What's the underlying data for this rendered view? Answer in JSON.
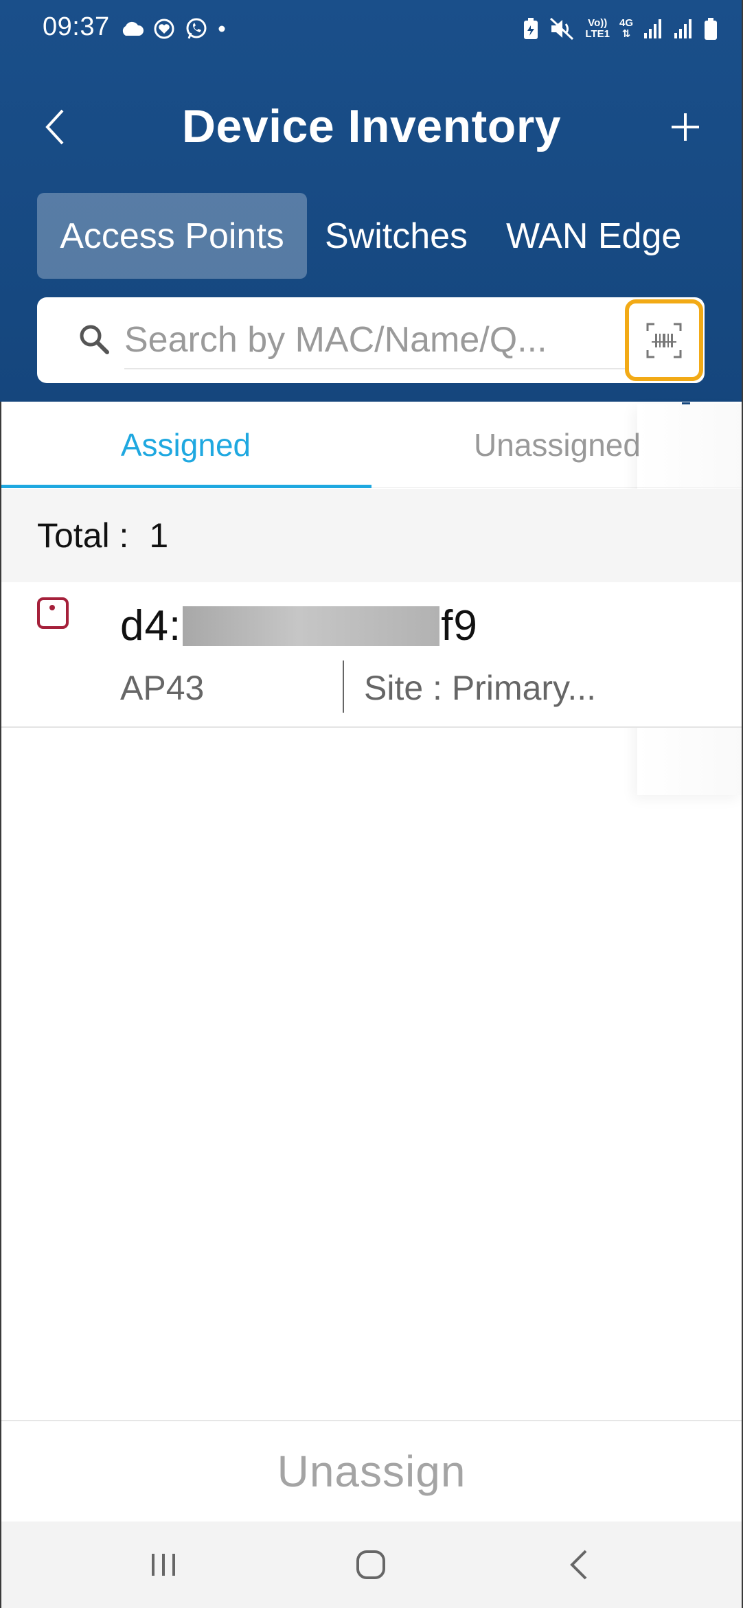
{
  "status_bar": {
    "time": "09:37",
    "left_icons": [
      "cloud-icon",
      "heart-sync-icon",
      "whatsapp-icon",
      "dot-icon"
    ],
    "right_icons": [
      "battery-saver-icon",
      "mute-icon",
      "volte-icon",
      "4g-icon",
      "signal-icon",
      "signal-icon-2",
      "battery-icon"
    ],
    "volte_label_top": "Vo))",
    "volte_label_bottom": "LTE1",
    "network_label": "4G"
  },
  "app_bar": {
    "title": "Device Inventory",
    "back_icon": "chevron-left-icon",
    "add_icon": "plus-icon"
  },
  "category_tabs": [
    {
      "label": "Access Points",
      "active": true
    },
    {
      "label": "Switches",
      "active": false
    },
    {
      "label": "WAN Edge",
      "active": false
    }
  ],
  "search": {
    "placeholder": "Search by MAC/Name/Q...",
    "icon": "search-icon",
    "scan_icon": "barcode-scan-icon"
  },
  "assign_tabs": {
    "assigned": "Assigned",
    "unassigned": "Unassigned",
    "active": "assigned"
  },
  "total": {
    "label": "Total :",
    "count": "1"
  },
  "devices": [
    {
      "mac_prefix": "d4:",
      "mac_suffix": "f9",
      "model": "AP43",
      "site": "Site : Primary..."
    }
  ],
  "actions": {
    "unassign": "Unassign"
  },
  "colors": {
    "header": "#15467d",
    "accent": "#1fa8e0",
    "scan_highlight": "#f2aa16",
    "device_icon": "#a5203a"
  }
}
